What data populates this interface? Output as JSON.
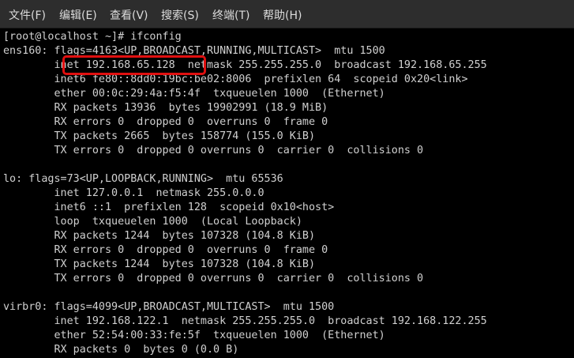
{
  "menubar": {
    "items": [
      {
        "label": "文件(F)"
      },
      {
        "label": "编辑(E)"
      },
      {
        "label": "查看(V)"
      },
      {
        "label": "搜索(S)"
      },
      {
        "label": "终端(T)"
      },
      {
        "label": "帮助(H)"
      }
    ]
  },
  "terminal": {
    "lines": [
      "[root@localhost ~]# ifconfig",
      "ens160: flags=4163<UP,BROADCAST,RUNNING,MULTICAST>  mtu 1500",
      "        inet 192.168.65.128  netmask 255.255.255.0  broadcast 192.168.65.255",
      "        inet6 fe80::8dd0:19bc:be02:8006  prefixlen 64  scopeid 0x20<link>",
      "        ether 00:0c:29:4a:f5:4f  txqueuelen 1000  (Ethernet)",
      "        RX packets 13936  bytes 19902991 (18.9 MiB)",
      "        RX errors 0  dropped 0  overruns 0  frame 0",
      "        TX packets 2665  bytes 158774 (155.0 KiB)",
      "        TX errors 0  dropped 0 overruns 0  carrier 0  collisions 0",
      "",
      "lo: flags=73<UP,LOOPBACK,RUNNING>  mtu 65536",
      "        inet 127.0.0.1  netmask 255.0.0.0",
      "        inet6 ::1  prefixlen 128  scopeid 0x10<host>",
      "        loop  txqueuelen 1000  (Local Loopback)",
      "        RX packets 1244  bytes 107328 (104.8 KiB)",
      "        RX errors 0  dropped 0  overruns 0  frame 0",
      "        TX packets 1244  bytes 107328 (104.8 KiB)",
      "        TX errors 0  dropped 0 overruns 0  carrier 0  collisions 0",
      "",
      "virbr0: flags=4099<UP,BROADCAST,MULTICAST>  mtu 1500",
      "        inet 192.168.122.1  netmask 255.255.255.0  broadcast 192.168.122.255",
      "        ether 52:54:00:33:fe:5f  txqueuelen 1000  (Ethernet)",
      "        RX packets 0  bytes 0 (0.0 B)"
    ]
  },
  "colors": {
    "menubar_bg": "#2d2d2d",
    "terminal_bg": "#000000",
    "terminal_text": "#d0d0d0",
    "highlight": "#e01010"
  }
}
